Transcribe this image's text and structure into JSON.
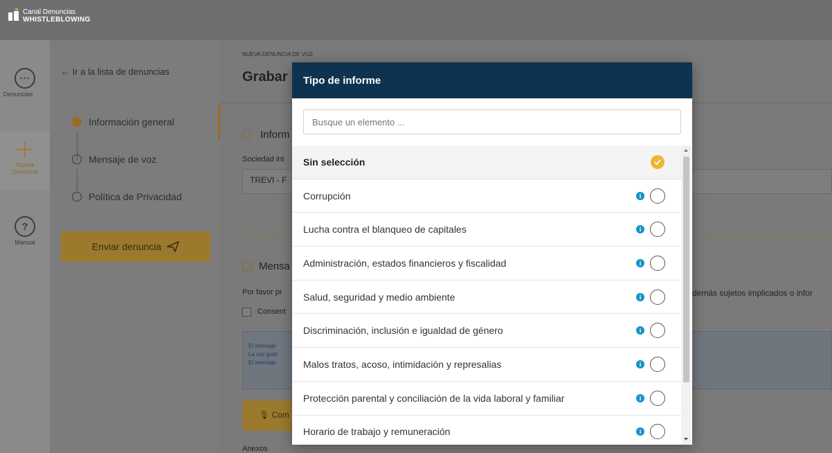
{
  "app": {
    "brand_line1": "Canal Denuncias",
    "brand_line2": "WHISTLEBLOWING"
  },
  "rail": {
    "items": [
      {
        "label": "Denuncias",
        "icon": "chat-bubble-icon"
      },
      {
        "label": "Nueva\nDenuncia",
        "icon": "plus-icon"
      },
      {
        "label": "Manual",
        "icon": "question-circle-icon"
      }
    ]
  },
  "steps": {
    "back_link": "Ir a la lista de denuncias",
    "items": [
      {
        "label": "Información general",
        "active": true
      },
      {
        "label": "Mensaje de voz",
        "active": false
      },
      {
        "label": "Política de Privacidad",
        "active": false
      }
    ],
    "send_button": "Enviar denuncia"
  },
  "main": {
    "subtitle": "NUEVA DENUNCIA DE VOZ",
    "title": "Grabar",
    "section1_title": "Inform",
    "company_label": "Sociedad int",
    "company_value": "TREVI - F",
    "section2_title": "Mensa",
    "consent_text": "Por favor pr",
    "consent_text_right": "demás sujetos implicados o infor",
    "consent_checkbox_label": "Consent",
    "info_lines": [
      "El mensaje",
      "La voz grab",
      "El mensaje"
    ],
    "record_button": "Com",
    "annex_label": "Anexos"
  },
  "modal": {
    "title": "Tipo de informe",
    "search_placeholder": "Busque un elemento ...",
    "options": [
      {
        "label": "Sin selección",
        "selected": true,
        "has_info": false
      },
      {
        "label": "Corrupción",
        "selected": false,
        "has_info": true
      },
      {
        "label": "Lucha contra el blanqueo de capitales",
        "selected": false,
        "has_info": true
      },
      {
        "label": "Administración, estados financieros y fiscalidad",
        "selected": false,
        "has_info": true
      },
      {
        "label": "Salud, seguridad y medio ambiente",
        "selected": false,
        "has_info": true
      },
      {
        "label": "Discriminación, inclusión e igualdad de género",
        "selected": false,
        "has_info": true
      },
      {
        "label": "Malos tratos, acoso, intimidación y represalias",
        "selected": false,
        "has_info": true
      },
      {
        "label": "Protección parental y conciliación de la vida laboral y familiar",
        "selected": false,
        "has_info": true
      },
      {
        "label": "Horario de trabajo y remuneración",
        "selected": false,
        "has_info": true
      }
    ]
  },
  "colors": {
    "modal_header": "#0e3350",
    "accent": "#f1b532",
    "info": "#1890c8"
  }
}
